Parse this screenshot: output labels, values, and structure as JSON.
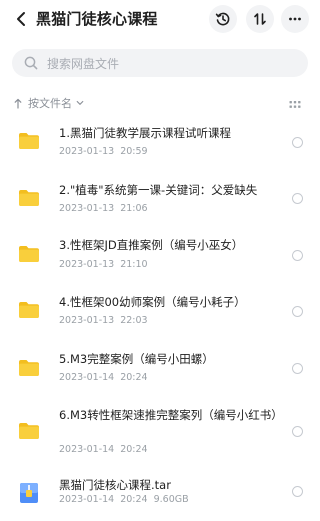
{
  "header": {
    "title": "黑猫门徒核心课程"
  },
  "search": {
    "placeholder": "搜索网盘文件"
  },
  "sort": {
    "label": "按文件名"
  },
  "files": [
    {
      "name": "1.黑猫门徒教学展示课程试听课程",
      "date": "2023-01-13",
      "time": "20:59",
      "size": "",
      "type": "folder"
    },
    {
      "name": "2.\"植毒\"系统第一课-关键词：父爱缺失",
      "date": "2023-01-13",
      "time": "21:06",
      "size": "",
      "type": "folder"
    },
    {
      "name": "3.性框架JD直推案例（编号小巫女）",
      "date": "2023-01-13",
      "time": "21:10",
      "size": "",
      "type": "folder"
    },
    {
      "name": "4.性框架00幼师案例（编号小耗子）",
      "date": "2023-01-13",
      "time": "22:03",
      "size": "",
      "type": "folder"
    },
    {
      "name": "5.M3完整案例（编号小田螺）",
      "date": "2023-01-14",
      "time": "20:24",
      "size": "",
      "type": "folder"
    },
    {
      "name": "6.M3转性框架速推完整案列（编号小红书）",
      "date": "2023-01-14",
      "time": "20:24",
      "size": "",
      "type": "folder"
    },
    {
      "name": "黑猫门徒核心课程.tar",
      "date": "2023-01-14",
      "time": "20:24",
      "size": "9.60GB",
      "type": "archive"
    }
  ],
  "colors": {
    "folder": "#f9cf3c",
    "folder_back": "#f3be1f",
    "text_primary": "#1f1f1f",
    "text_secondary": "#9aa0a6",
    "surface": "#f2f3f5"
  }
}
